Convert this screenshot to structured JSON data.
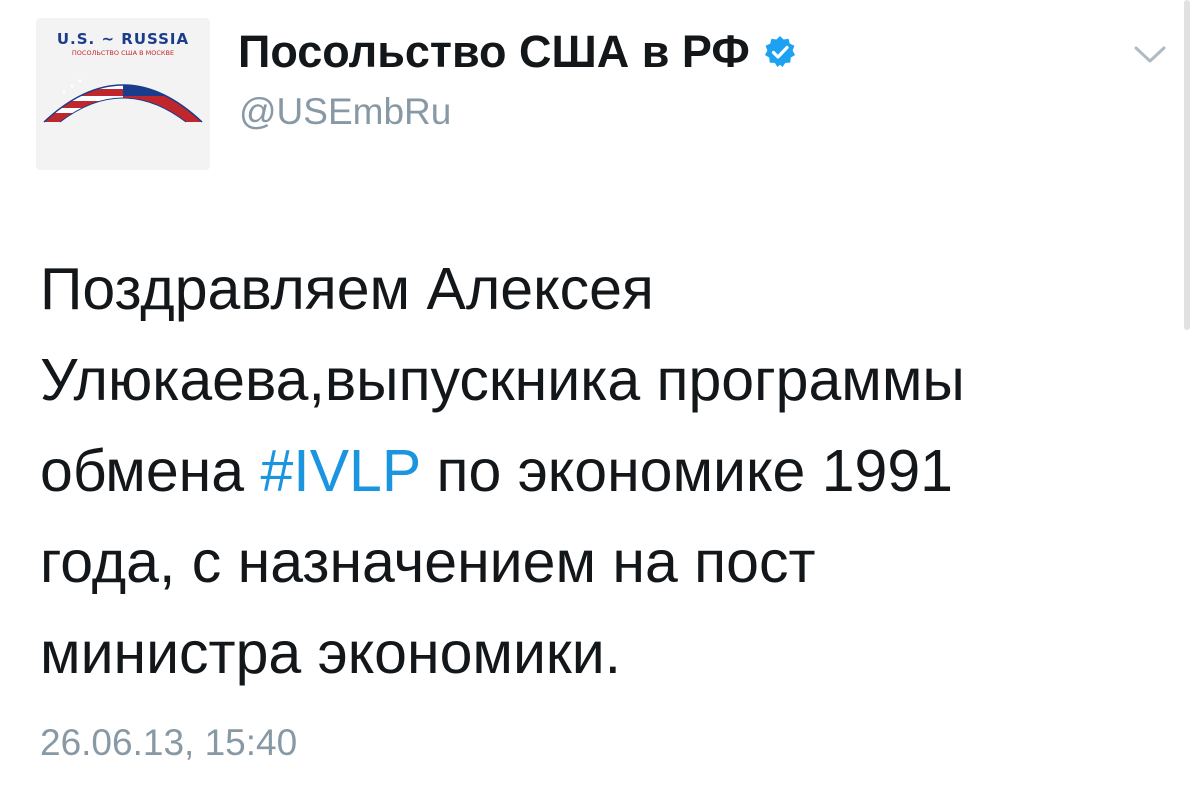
{
  "avatar": {
    "title_text": "U.S. ~ RUSSIA",
    "subtitle_text": "ПОСОЛЬСТВО США В МОСКВЕ",
    "colors": {
      "blue": "#1b3c8c",
      "red": "#c0272d",
      "white": "#ffffff"
    }
  },
  "user": {
    "display_name": "Посольство США в РФ",
    "handle": "@USEmbRu",
    "verified": true
  },
  "tweet": {
    "lines": [
      {
        "text": "Поздравляем Алексея"
      },
      {
        "text": "Улюкаева,выпускника программы"
      },
      {
        "before": "обмена ",
        "hashtag": "#IVLP",
        "after": " по экономике 1991"
      },
      {
        "text": "года, с назначением на пост"
      },
      {
        "text": "министра экономики."
      }
    ],
    "timestamp": "26.06.13, 15:40"
  },
  "colors": {
    "text": "#14171a",
    "secondary": "#8899a6",
    "link": "#1b95e0",
    "verified_badge": "#1da1f2"
  }
}
